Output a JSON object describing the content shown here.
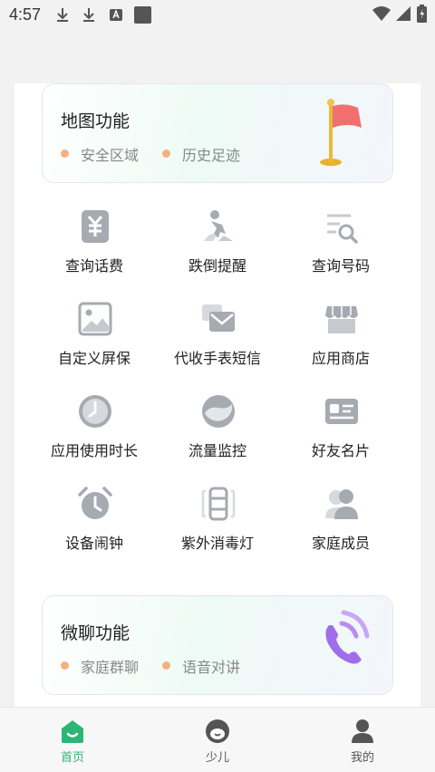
{
  "status_bar": {
    "time": "4:57"
  },
  "map_card": {
    "title": "地图功能",
    "tags": [
      "安全区域",
      "历史足迹"
    ]
  },
  "features": [
    {
      "label": "查询话费",
      "icon": "yuan-bill-icon"
    },
    {
      "label": "跌倒提醒",
      "icon": "falling-person-icon"
    },
    {
      "label": "查询号码",
      "icon": "search-list-icon"
    },
    {
      "label": "自定义屏保",
      "icon": "image-icon"
    },
    {
      "label": "代收手表短信",
      "icon": "message-envelope-icon"
    },
    {
      "label": "应用商店",
      "icon": "store-icon"
    },
    {
      "label": "应用使用时长",
      "icon": "clock-icon"
    },
    {
      "label": "流量监控",
      "icon": "gauge-icon"
    },
    {
      "label": "好友名片",
      "icon": "id-card-icon"
    },
    {
      "label": "设备闹钟",
      "icon": "alarm-clock-icon"
    },
    {
      "label": "紫外消毒灯",
      "icon": "uv-lamp-icon"
    },
    {
      "label": "家庭成员",
      "icon": "family-icon"
    }
  ],
  "chat_card": {
    "title": "微聊功能",
    "tags": [
      "家庭群聊",
      "语音对讲"
    ]
  },
  "bottom_nav": [
    {
      "label": "首页",
      "icon": "home-icon",
      "active": true
    },
    {
      "label": "少儿",
      "icon": "child-face-icon",
      "active": false
    },
    {
      "label": "我的",
      "icon": "person-icon",
      "active": false
    }
  ],
  "colors": {
    "accent": "#2bb673",
    "icon_gray": "#9aa0a6",
    "tag_dot": "#f2b27e"
  }
}
